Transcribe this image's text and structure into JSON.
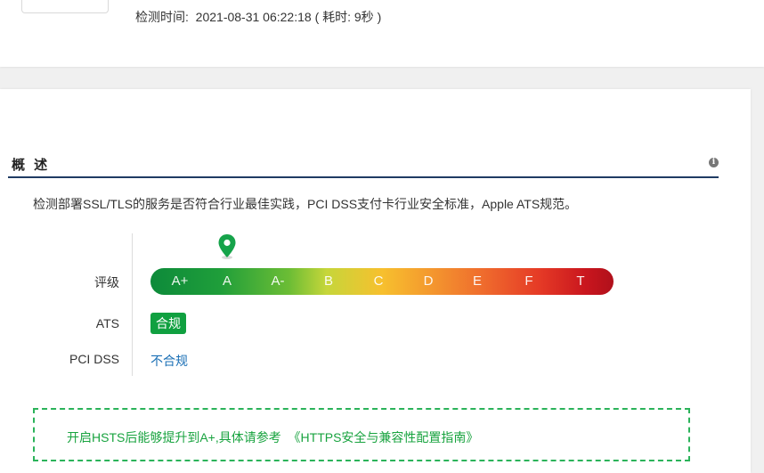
{
  "header": {
    "detect_time_label": "检测时间:",
    "detect_time_value": "2021-08-31 06:22:18",
    "duration_text": "( 耗时: 9秒 )"
  },
  "overview": {
    "title": "概 述",
    "info_icon": "info-icon",
    "description": "检测部署SSL/TLS的服务是否符合行业最佳实践，PCI DSS支付卡行业安全标准，Apple ATS规范。"
  },
  "rating": {
    "label": "评级",
    "grades": [
      "A+",
      "A",
      "A-",
      "B",
      "C",
      "D",
      "E",
      "F",
      "T"
    ],
    "current_grade": "A",
    "marker_icon": "map-pin-icon"
  },
  "ats": {
    "label": "ATS",
    "status": "合规",
    "status_color": "#10a040"
  },
  "pci": {
    "label": "PCI DSS",
    "status": "不合规",
    "status_color": "#1a6fb5"
  },
  "tip": {
    "text": "开启HSTS后能够提升到A+,具体请参考",
    "link_text": "《HTTPS安全与兼容性配置指南》",
    "color": "#18a33f"
  }
}
